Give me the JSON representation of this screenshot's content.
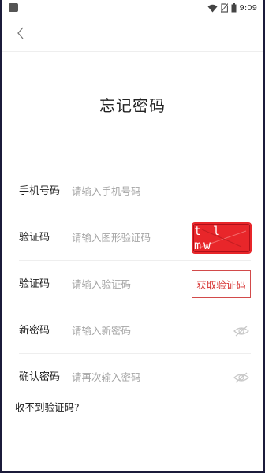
{
  "status_bar": {
    "time": "9:09",
    "icons": [
      "wifi-icon",
      "no-sim-icon",
      "battery-icon"
    ]
  },
  "header": {
    "back_icon": "chevron-left-icon"
  },
  "page_title": "忘记密码",
  "form": {
    "phone": {
      "label": "手机号码",
      "placeholder": "请输入手机号码"
    },
    "image_code": {
      "label": "验证码",
      "placeholder": "请输入图形验证码",
      "captcha_text": "t l mw"
    },
    "sms_code": {
      "label": "验证码",
      "placeholder": "请输入验证码",
      "button_label": "获取验证码"
    },
    "new_password": {
      "label": "新密码",
      "placeholder": "请输入新密码",
      "icon": "eye-off-icon"
    },
    "confirm_password": {
      "label": "确认密码",
      "placeholder": "请再次输入密码",
      "icon": "eye-off-icon"
    }
  },
  "footer_link": "收不到验证码?",
  "colors": {
    "accent": "#e8262a",
    "placeholder": "#a5a5a5",
    "divider": "#eeeeee"
  }
}
